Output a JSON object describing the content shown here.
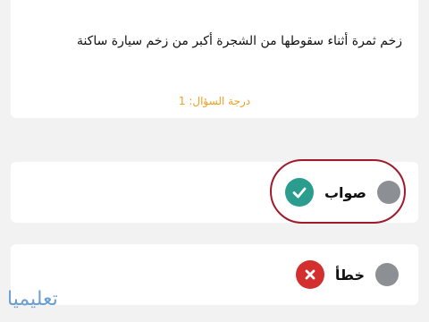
{
  "question": {
    "text": "زخم ثمرة أثناء سقوطها من الشجرة أكبر من زخم سيارة ساكنة",
    "grade": "درجة السؤال: 1"
  },
  "options": [
    {
      "label": "صواب",
      "result_icon": "check-icon",
      "result_color": "#2a9d8f",
      "selected": true
    },
    {
      "label": "خطأ",
      "result_icon": "close-icon",
      "result_color": "#d32f2f",
      "selected": false
    }
  ],
  "colors": {
    "radio": "#8c8f93",
    "grade_text": "#f0a020",
    "highlight_ring": "#a11a2c"
  },
  "watermark": "تعليميا"
}
